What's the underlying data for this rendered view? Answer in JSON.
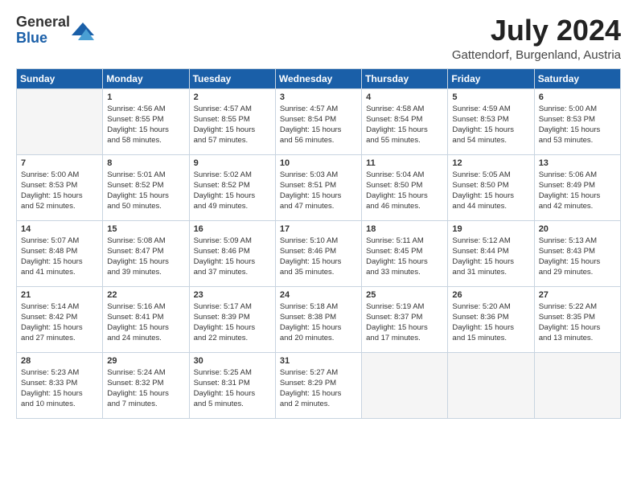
{
  "header": {
    "logo_general": "General",
    "logo_blue": "Blue",
    "month_year": "July 2024",
    "location": "Gattendorf, Burgenland, Austria"
  },
  "days_of_week": [
    "Sunday",
    "Monday",
    "Tuesday",
    "Wednesday",
    "Thursday",
    "Friday",
    "Saturday"
  ],
  "weeks": [
    [
      {
        "day": "",
        "lines": []
      },
      {
        "day": "1",
        "lines": [
          "Sunrise: 4:56 AM",
          "Sunset: 8:55 PM",
          "Daylight: 15 hours",
          "and 58 minutes."
        ]
      },
      {
        "day": "2",
        "lines": [
          "Sunrise: 4:57 AM",
          "Sunset: 8:55 PM",
          "Daylight: 15 hours",
          "and 57 minutes."
        ]
      },
      {
        "day": "3",
        "lines": [
          "Sunrise: 4:57 AM",
          "Sunset: 8:54 PM",
          "Daylight: 15 hours",
          "and 56 minutes."
        ]
      },
      {
        "day": "4",
        "lines": [
          "Sunrise: 4:58 AM",
          "Sunset: 8:54 PM",
          "Daylight: 15 hours",
          "and 55 minutes."
        ]
      },
      {
        "day": "5",
        "lines": [
          "Sunrise: 4:59 AM",
          "Sunset: 8:53 PM",
          "Daylight: 15 hours",
          "and 54 minutes."
        ]
      },
      {
        "day": "6",
        "lines": [
          "Sunrise: 5:00 AM",
          "Sunset: 8:53 PM",
          "Daylight: 15 hours",
          "and 53 minutes."
        ]
      }
    ],
    [
      {
        "day": "7",
        "lines": [
          "Sunrise: 5:00 AM",
          "Sunset: 8:53 PM",
          "Daylight: 15 hours",
          "and 52 minutes."
        ]
      },
      {
        "day": "8",
        "lines": [
          "Sunrise: 5:01 AM",
          "Sunset: 8:52 PM",
          "Daylight: 15 hours",
          "and 50 minutes."
        ]
      },
      {
        "day": "9",
        "lines": [
          "Sunrise: 5:02 AM",
          "Sunset: 8:52 PM",
          "Daylight: 15 hours",
          "and 49 minutes."
        ]
      },
      {
        "day": "10",
        "lines": [
          "Sunrise: 5:03 AM",
          "Sunset: 8:51 PM",
          "Daylight: 15 hours",
          "and 47 minutes."
        ]
      },
      {
        "day": "11",
        "lines": [
          "Sunrise: 5:04 AM",
          "Sunset: 8:50 PM",
          "Daylight: 15 hours",
          "and 46 minutes."
        ]
      },
      {
        "day": "12",
        "lines": [
          "Sunrise: 5:05 AM",
          "Sunset: 8:50 PM",
          "Daylight: 15 hours",
          "and 44 minutes."
        ]
      },
      {
        "day": "13",
        "lines": [
          "Sunrise: 5:06 AM",
          "Sunset: 8:49 PM",
          "Daylight: 15 hours",
          "and 42 minutes."
        ]
      }
    ],
    [
      {
        "day": "14",
        "lines": [
          "Sunrise: 5:07 AM",
          "Sunset: 8:48 PM",
          "Daylight: 15 hours",
          "and 41 minutes."
        ]
      },
      {
        "day": "15",
        "lines": [
          "Sunrise: 5:08 AM",
          "Sunset: 8:47 PM",
          "Daylight: 15 hours",
          "and 39 minutes."
        ]
      },
      {
        "day": "16",
        "lines": [
          "Sunrise: 5:09 AM",
          "Sunset: 8:46 PM",
          "Daylight: 15 hours",
          "and 37 minutes."
        ]
      },
      {
        "day": "17",
        "lines": [
          "Sunrise: 5:10 AM",
          "Sunset: 8:46 PM",
          "Daylight: 15 hours",
          "and 35 minutes."
        ]
      },
      {
        "day": "18",
        "lines": [
          "Sunrise: 5:11 AM",
          "Sunset: 8:45 PM",
          "Daylight: 15 hours",
          "and 33 minutes."
        ]
      },
      {
        "day": "19",
        "lines": [
          "Sunrise: 5:12 AM",
          "Sunset: 8:44 PM",
          "Daylight: 15 hours",
          "and 31 minutes."
        ]
      },
      {
        "day": "20",
        "lines": [
          "Sunrise: 5:13 AM",
          "Sunset: 8:43 PM",
          "Daylight: 15 hours",
          "and 29 minutes."
        ]
      }
    ],
    [
      {
        "day": "21",
        "lines": [
          "Sunrise: 5:14 AM",
          "Sunset: 8:42 PM",
          "Daylight: 15 hours",
          "and 27 minutes."
        ]
      },
      {
        "day": "22",
        "lines": [
          "Sunrise: 5:16 AM",
          "Sunset: 8:41 PM",
          "Daylight: 15 hours",
          "and 24 minutes."
        ]
      },
      {
        "day": "23",
        "lines": [
          "Sunrise: 5:17 AM",
          "Sunset: 8:39 PM",
          "Daylight: 15 hours",
          "and 22 minutes."
        ]
      },
      {
        "day": "24",
        "lines": [
          "Sunrise: 5:18 AM",
          "Sunset: 8:38 PM",
          "Daylight: 15 hours",
          "and 20 minutes."
        ]
      },
      {
        "day": "25",
        "lines": [
          "Sunrise: 5:19 AM",
          "Sunset: 8:37 PM",
          "Daylight: 15 hours",
          "and 17 minutes."
        ]
      },
      {
        "day": "26",
        "lines": [
          "Sunrise: 5:20 AM",
          "Sunset: 8:36 PM",
          "Daylight: 15 hours",
          "and 15 minutes."
        ]
      },
      {
        "day": "27",
        "lines": [
          "Sunrise: 5:22 AM",
          "Sunset: 8:35 PM",
          "Daylight: 15 hours",
          "and 13 minutes."
        ]
      }
    ],
    [
      {
        "day": "28",
        "lines": [
          "Sunrise: 5:23 AM",
          "Sunset: 8:33 PM",
          "Daylight: 15 hours",
          "and 10 minutes."
        ]
      },
      {
        "day": "29",
        "lines": [
          "Sunrise: 5:24 AM",
          "Sunset: 8:32 PM",
          "Daylight: 15 hours",
          "and 7 minutes."
        ]
      },
      {
        "day": "30",
        "lines": [
          "Sunrise: 5:25 AM",
          "Sunset: 8:31 PM",
          "Daylight: 15 hours",
          "and 5 minutes."
        ]
      },
      {
        "day": "31",
        "lines": [
          "Sunrise: 5:27 AM",
          "Sunset: 8:29 PM",
          "Daylight: 15 hours",
          "and 2 minutes."
        ]
      },
      {
        "day": "",
        "lines": []
      },
      {
        "day": "",
        "lines": []
      },
      {
        "day": "",
        "lines": []
      }
    ]
  ]
}
